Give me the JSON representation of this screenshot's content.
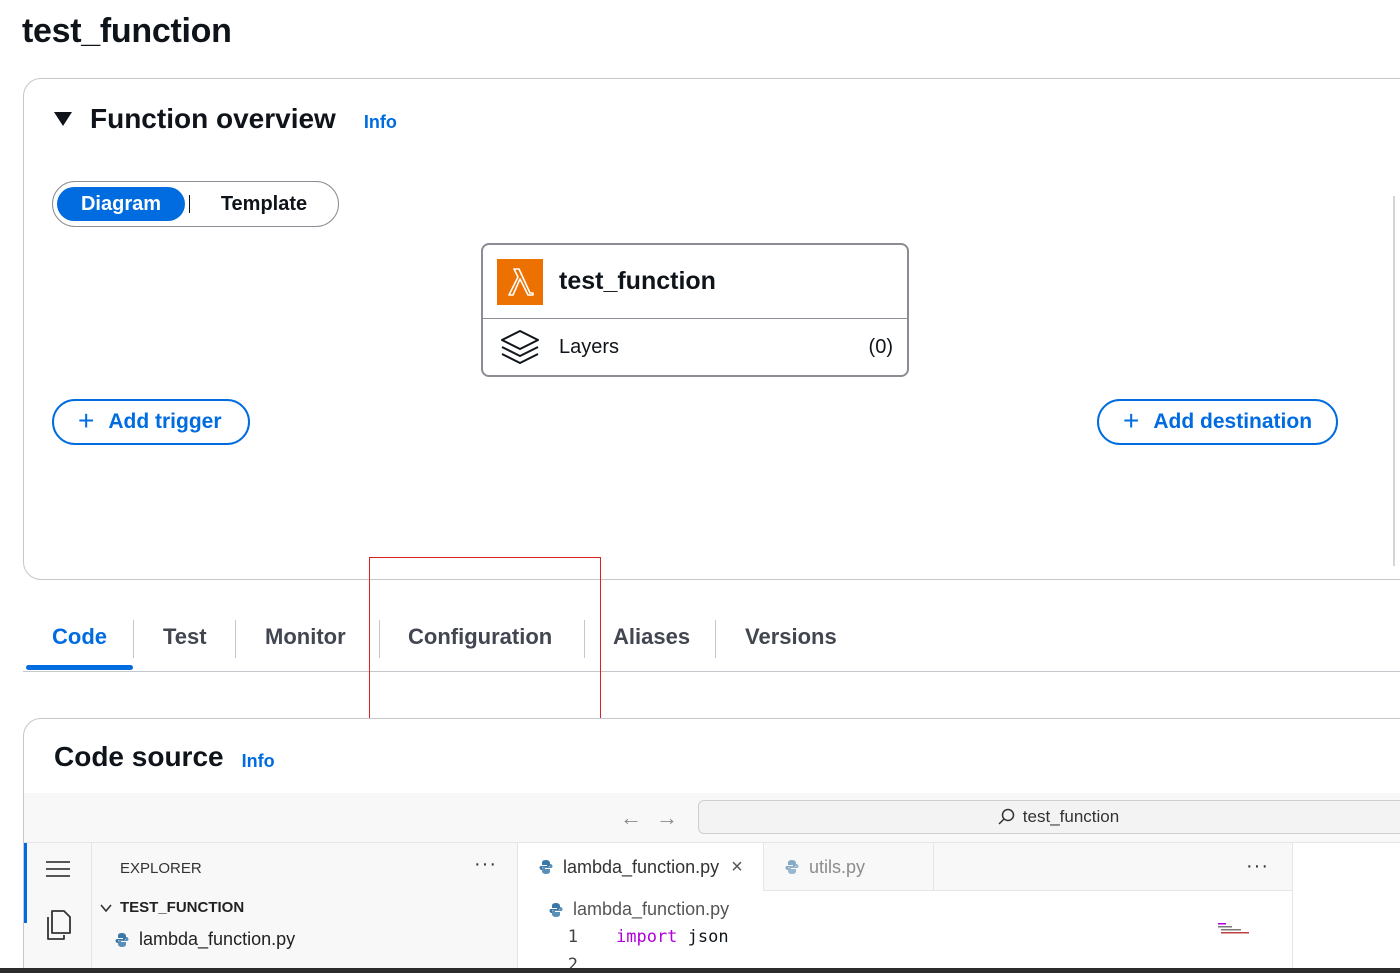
{
  "page": {
    "title": "test_function"
  },
  "overview": {
    "title": "Function overview",
    "info": "Info",
    "view_toggle": {
      "options": [
        "Diagram",
        "Template"
      ],
      "selected": "Diagram"
    },
    "function_card": {
      "name": "test_function",
      "layers_label": "Layers",
      "layers_count": "(0)"
    },
    "add_trigger": "Add trigger",
    "add_destination": "Add destination"
  },
  "tabs": [
    {
      "label": "Code",
      "active": true
    },
    {
      "label": "Test",
      "active": false
    },
    {
      "label": "Monitor",
      "active": false
    },
    {
      "label": "Configuration",
      "active": false
    },
    {
      "label": "Aliases",
      "active": false
    },
    {
      "label": "Versions",
      "active": false
    }
  ],
  "code_source": {
    "title": "Code source",
    "info": "Info",
    "search": "test_function",
    "explorer": {
      "title": "EXPLORER",
      "folder": "TEST_FUNCTION",
      "files": [
        "lambda_function.py"
      ]
    },
    "editor": {
      "tabs": [
        {
          "label": "lambda_function.py",
          "active": true
        },
        {
          "label": "utils.py",
          "active": false
        }
      ],
      "breadcrumb": "lambda_function.py",
      "lines": [
        {
          "num": "1",
          "keyword": "import",
          "rest": " json"
        },
        {
          "num": "2",
          "keyword": "",
          "rest": ""
        }
      ]
    }
  },
  "colors": {
    "accent": "#006ce0",
    "lambda_orange": "#ed7100",
    "highlight": "#e02020"
  }
}
